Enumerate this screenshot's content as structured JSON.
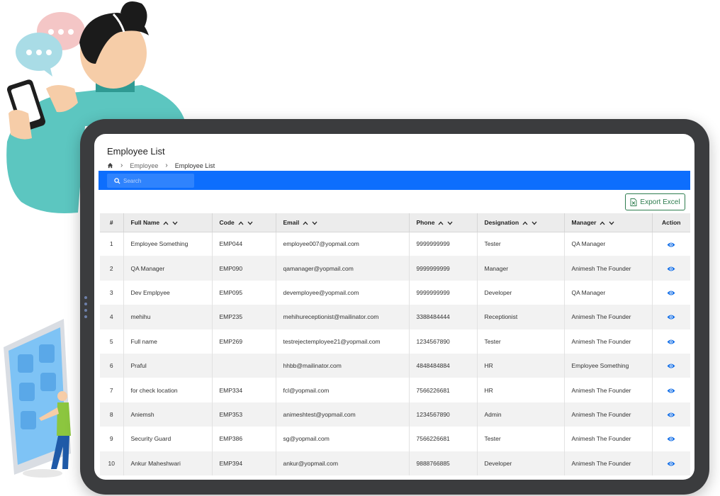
{
  "page": {
    "title": "Employee List",
    "breadcrumb": [
      "Employee",
      "Employee List"
    ]
  },
  "search": {
    "placeholder": "Search"
  },
  "toolbar": {
    "export_label": "Export Excel"
  },
  "colors": {
    "accent": "#0d6efd",
    "export": "#2e7d4f",
    "view_icon": "#1a73e8"
  },
  "table": {
    "columns": [
      "#",
      "Full Name",
      "Code",
      "Email",
      "Phone",
      "Designation",
      "Manager",
      "Action"
    ],
    "rows": [
      {
        "idx": "1",
        "name": "Employee Something",
        "code": "EMP044",
        "email": "employee007@yopmail.com",
        "phone": "9999999999",
        "designation": "Tester",
        "manager": "QA Manager"
      },
      {
        "idx": "2",
        "name": "QA Manager",
        "code": "EMP090",
        "email": "qamanager@yopmail.com",
        "phone": "9999999999",
        "designation": "Manager",
        "manager": "Animesh The Founder"
      },
      {
        "idx": "3",
        "name": "Dev Emplpyee",
        "code": "EMP095",
        "email": "devemployee@yopmail.com",
        "phone": "9999999999",
        "designation": "Developer",
        "manager": "QA Manager"
      },
      {
        "idx": "4",
        "name": "mehihu",
        "code": "EMP235",
        "email": "mehihureceptionist@mailinator.com",
        "phone": "3388484444",
        "designation": "Receptionist",
        "manager": "Animesh The Founder"
      },
      {
        "idx": "5",
        "name": "Full name",
        "code": "EMP269",
        "email": "testrejectemployee21@yopmail.com",
        "phone": "1234567890",
        "designation": "Tester",
        "manager": "Animesh The Founder"
      },
      {
        "idx": "6",
        "name": "Praful",
        "code": "",
        "email": "hhbb@mailinator.com",
        "phone": "4848484884",
        "designation": "HR",
        "manager": "Employee Something"
      },
      {
        "idx": "7",
        "name": "for check location",
        "code": "EMP334",
        "email": "fcl@yopmail.com",
        "phone": "7566226681",
        "designation": "HR",
        "manager": "Animesh The Founder"
      },
      {
        "idx": "8",
        "name": "Aniemsh",
        "code": "EMP353",
        "email": "animeshtest@yopmail.com",
        "phone": "1234567890",
        "designation": "Admin",
        "manager": "Animesh The Founder"
      },
      {
        "idx": "9",
        "name": "Security Guard",
        "code": "EMP386",
        "email": "sg@yopmail.com",
        "phone": "7566226681",
        "designation": "Tester",
        "manager": "Animesh The Founder"
      },
      {
        "idx": "10",
        "name": "Ankur Maheshwari",
        "code": "EMP394",
        "email": "ankur@yopmail.com",
        "phone": "9888766885",
        "designation": "Developer",
        "manager": "Animesh The Founder"
      }
    ]
  },
  "icons": {
    "home": "home-icon",
    "breadcrumb_separator": "chevron-right-icon",
    "search": "search-icon",
    "export": "excel-file-icon",
    "sort_up": "chevron-up-icon",
    "sort_down": "chevron-down-icon",
    "view": "eye-icon"
  }
}
